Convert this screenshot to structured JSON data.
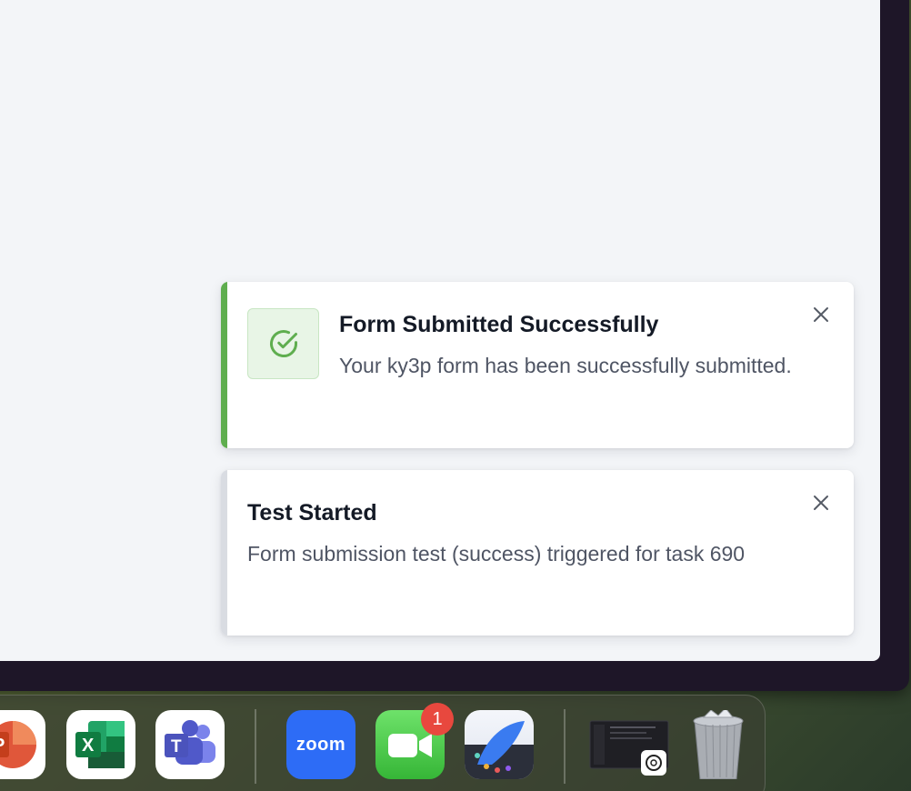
{
  "toasts": [
    {
      "type": "success",
      "title": "Form Submitted Successfully",
      "message": "Your ky3p form has been successfully submitted.",
      "icon": "check-circle-icon",
      "close_icon": "close-icon",
      "accent_color": "#5fae4f"
    },
    {
      "type": "info",
      "title": "Test Started",
      "message": "Form submission test (success) triggered for task 690",
      "close_icon": "close-icon",
      "accent_color": "#d9dce2"
    }
  ],
  "dock": {
    "apps": [
      {
        "name": "powerpoint",
        "icon": "powerpoint-icon"
      },
      {
        "name": "excel",
        "icon": "excel-icon",
        "glyph": "X"
      },
      {
        "name": "teams",
        "icon": "teams-icon",
        "glyph": "T"
      },
      {
        "name": "zoom",
        "icon": "zoom-icon",
        "label": "zoom"
      },
      {
        "name": "facetime",
        "icon": "facetime-icon",
        "badge": "1"
      },
      {
        "name": "freeform",
        "icon": "freeform-icon"
      },
      {
        "name": "chatgpt-window",
        "icon": "chatgpt-window-icon"
      },
      {
        "name": "trash",
        "icon": "trash-icon"
      }
    ]
  }
}
